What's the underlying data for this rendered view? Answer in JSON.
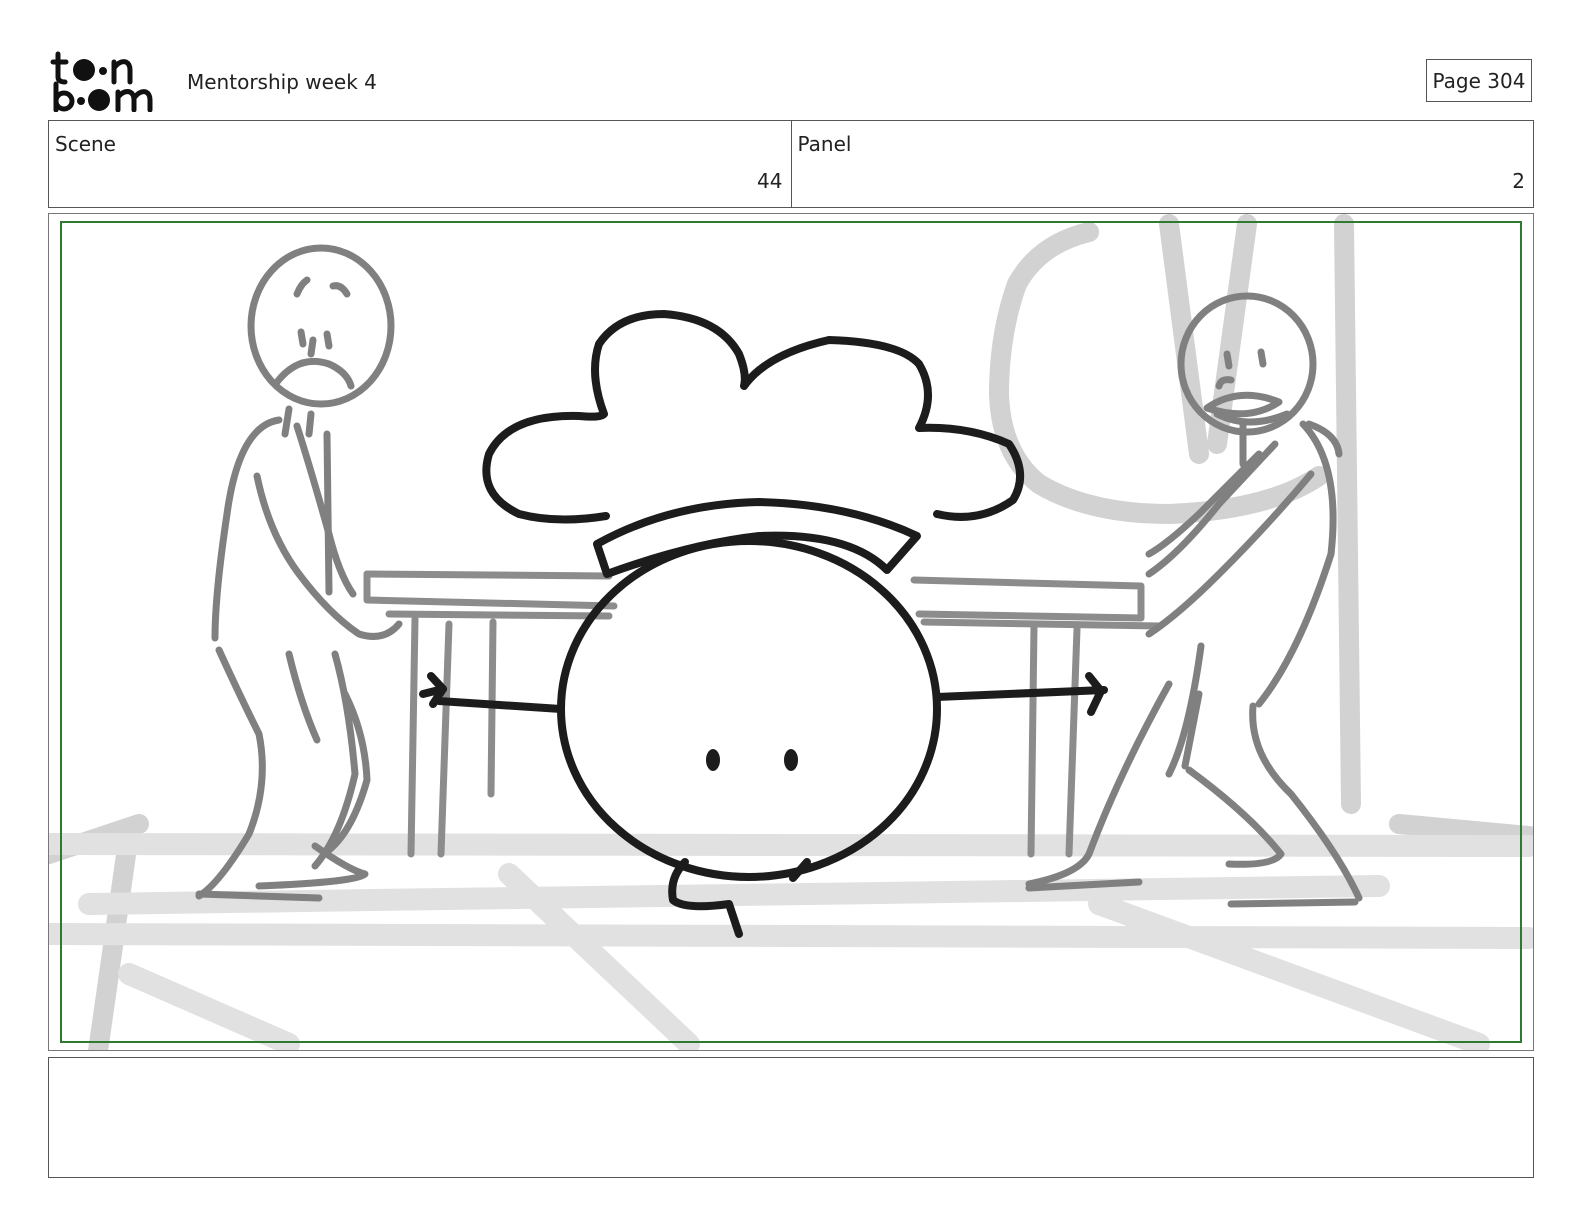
{
  "header": {
    "logo_text": "toon boom",
    "title": "Mentorship week 4",
    "page_label": "Page 304"
  },
  "info": {
    "scene_label": "Scene",
    "scene_value": "44",
    "panel_label": "Panel",
    "panel_value": "2"
  },
  "panel": {
    "illustration_icon": "storyboard-sketch-two-men-carrying-table-cartoon-chef",
    "safe_frame_color": "#2f7a2f"
  },
  "notes": {
    "text": ""
  }
}
